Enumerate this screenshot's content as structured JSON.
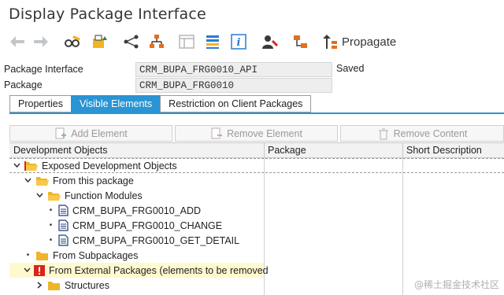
{
  "window": {
    "title": "Display Package Interface"
  },
  "toolbar": {
    "back_icon": "arrow-left-icon",
    "forward_icon": "arrow-right-icon",
    "propagate_label": "Propagate"
  },
  "fields": {
    "package_interface_label": "Package Interface",
    "package_interface_value": "CRM_BUPA_FRG0010_API",
    "status": "Saved",
    "package_label": "Package",
    "package_value": "CRM_BUPA_FRG0010"
  },
  "tabs": [
    {
      "label": "Properties",
      "active": false
    },
    {
      "label": "Visible Elements",
      "active": true
    },
    {
      "label": "Restriction on Client Packages",
      "active": false
    }
  ],
  "actions": {
    "add_element": "Add Element",
    "remove_element": "Remove Element",
    "remove_content": "Remove Content"
  },
  "columns": {
    "development_objects": "Development Objects",
    "package": "Package",
    "short_description": "Short Description"
  },
  "tree": [
    {
      "label": "Exposed Development Objects",
      "level": 0,
      "expanded": true,
      "icon": "folder-open-icon"
    },
    {
      "label": "From this package",
      "level": 1,
      "expanded": true,
      "icon": "folder-open-icon"
    },
    {
      "label": "Function Modules",
      "level": 2,
      "expanded": true,
      "icon": "folder-open-icon"
    },
    {
      "label": "CRM_BUPA_FRG0010_ADD",
      "level": 3,
      "icon": "document-icon"
    },
    {
      "label": "CRM_BUPA_FRG0010_CHANGE",
      "level": 3,
      "icon": "document-icon"
    },
    {
      "label": "CRM_BUPA_FRG0010_GET_DETAIL",
      "level": 3,
      "icon": "document-icon"
    },
    {
      "label": "From Subpackages",
      "level": 1,
      "icon": "folder-icon"
    },
    {
      "label": "From External Packages (elements to be removed",
      "level": 1,
      "expanded": true,
      "icon": "warning-icon"
    },
    {
      "label": "Structures",
      "level": 2,
      "expanded": false,
      "icon": "folder-icon"
    }
  ],
  "watermark": "@稀土掘金技术社区",
  "colors": {
    "accent": "#2a94d4",
    "folder": "#f0b429",
    "warning": "#d9261c",
    "highlight": "#fff9cf"
  }
}
